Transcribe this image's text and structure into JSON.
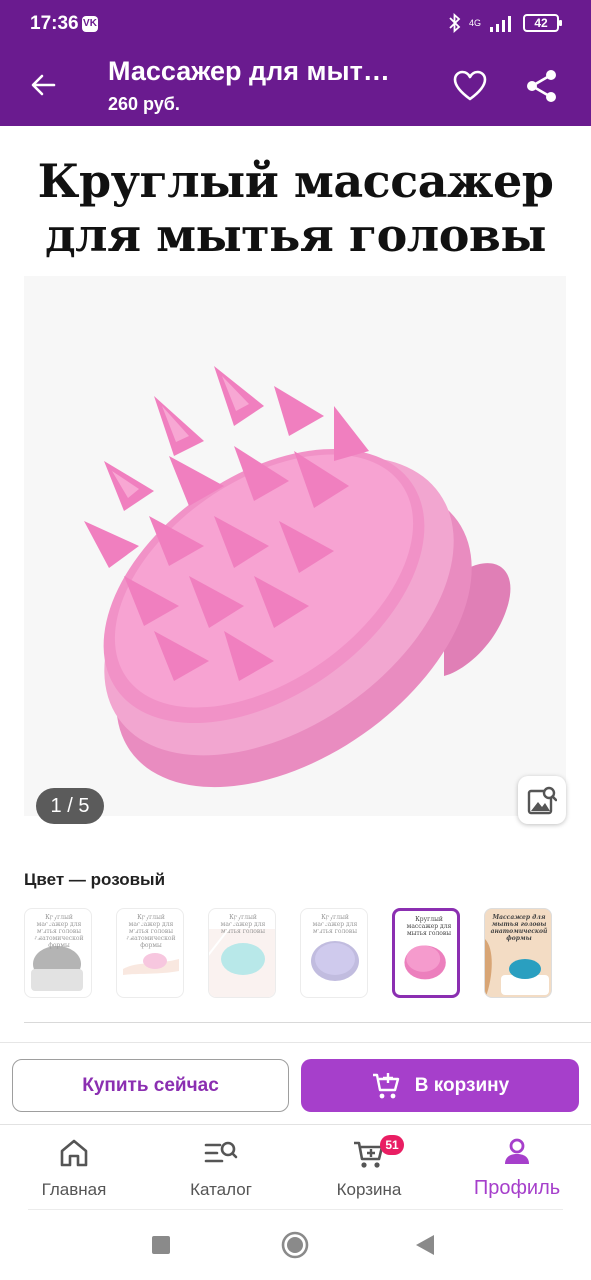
{
  "status_bar": {
    "time": "17:36",
    "app_badge": "VK",
    "network": "4G",
    "battery": "42"
  },
  "header": {
    "title": "Массажер для мыт…",
    "price": "260 руб."
  },
  "product": {
    "image_heading_line1": "Круглый массажер",
    "image_heading_line2": "для мытья головы",
    "counter": "1 / 5",
    "color_label": "Цвет — розовый",
    "thumb_captions": [
      "Круглый массажер для мытья головы анатомической формы",
      "Круглый массажер для мытья головы анатомической формы",
      "Круглый массажер для мытья головы",
      "Круглый массажер для мытья головы",
      "Круглый массажер для мытья головы",
      "Массажер для мытья головы анатомической формы"
    ]
  },
  "actions": {
    "buy_now": "Купить сейчас",
    "to_cart": "В корзину"
  },
  "nav": {
    "home": "Главная",
    "catalog": "Каталог",
    "cart": "Корзина",
    "cart_badge": "51",
    "profile": "Профиль"
  },
  "colors": {
    "brand": "#6a1b8f",
    "accent": "#a63fcb",
    "badge": "#e91e63",
    "product_pink": "#f08cc4"
  },
  "icons": [
    "back-arrow-icon",
    "heart-icon",
    "share-icon",
    "image-search-icon",
    "home-icon",
    "catalog-search-icon",
    "cart-icon",
    "profile-icon",
    "add-to-cart-icon"
  ]
}
